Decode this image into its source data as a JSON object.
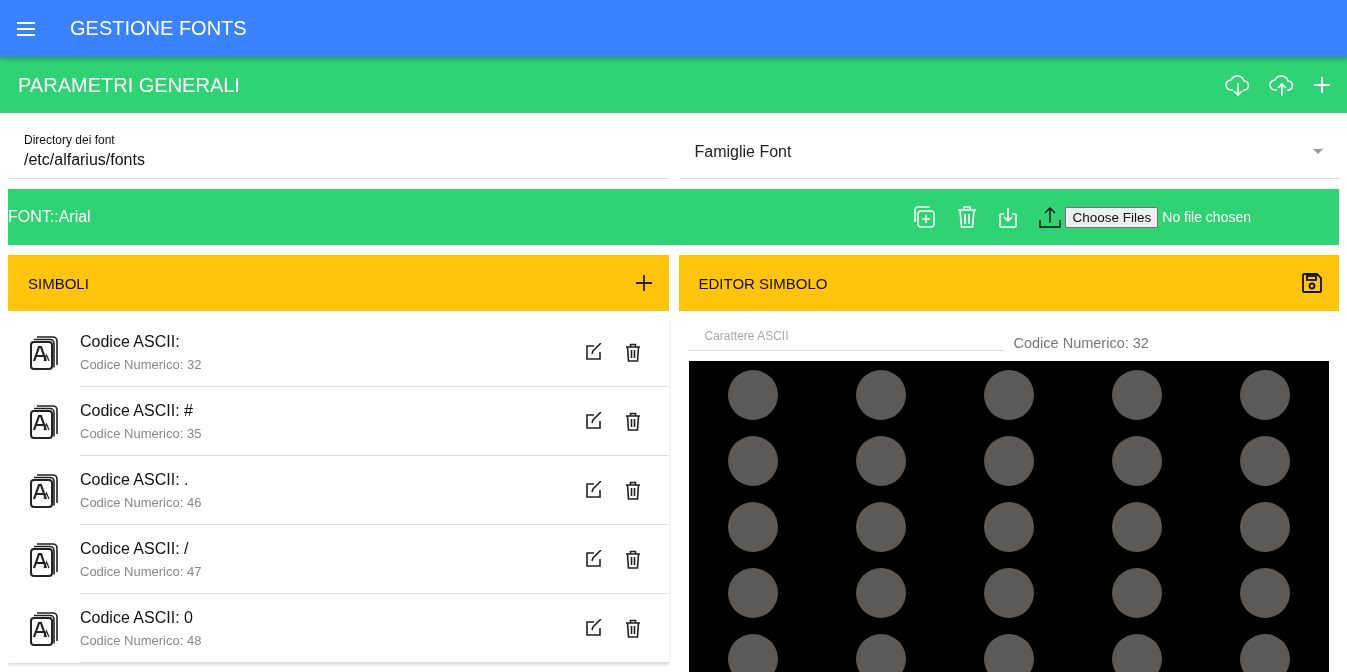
{
  "app_bar": {
    "title": "GESTIONE FONTS"
  },
  "section_bar": {
    "title": "PARAMETRI GENERALI"
  },
  "font_directory": {
    "label": "Directory dei font",
    "value": "/etc/alfarius/fonts"
  },
  "font_families": {
    "label": "Famiglie Font"
  },
  "font_bar": {
    "title": "FONT::Arial",
    "file_button": "Choose Files",
    "file_status": "No file chosen"
  },
  "symbols": {
    "title": "SIMBOLI",
    "items": [
      {
        "title": "Codice ASCII:",
        "subtitle": "Codice Numerico: 32"
      },
      {
        "title": "Codice ASCII: #",
        "subtitle": "Codice Numerico: 35"
      },
      {
        "title": "Codice ASCII: .",
        "subtitle": "Codice Numerico: 46"
      },
      {
        "title": "Codice ASCII: /",
        "subtitle": "Codice Numerico: 47"
      },
      {
        "title": "Codice ASCII: 0",
        "subtitle": "Codice Numerico: 48"
      }
    ]
  },
  "editor": {
    "title": "EDITOR SIMBOLO",
    "char_field": {
      "placeholder": "Carattere ASCII"
    },
    "numeric_code": "Codice Numerico: 32",
    "matrix": {
      "rows": [
        {
          "cells": [
            {
              "on": false
            },
            {
              "on": false
            },
            {
              "on": false
            },
            {
              "on": false
            },
            {
              "on": false
            }
          ]
        },
        {
          "cells": [
            {
              "on": false
            },
            {
              "on": false
            },
            {
              "on": false
            },
            {
              "on": false
            },
            {
              "on": false
            }
          ]
        },
        {
          "cells": [
            {
              "on": false
            },
            {
              "on": false
            },
            {
              "on": false
            },
            {
              "on": false
            },
            {
              "on": false
            }
          ]
        },
        {
          "cells": [
            {
              "on": false
            },
            {
              "on": false
            },
            {
              "on": false
            },
            {
              "on": false
            },
            {
              "on": false
            }
          ]
        },
        {
          "cells": [
            {
              "on": false
            },
            {
              "on": false
            },
            {
              "on": false
            },
            {
              "on": false
            },
            {
              "on": false
            }
          ]
        }
      ]
    }
  }
}
